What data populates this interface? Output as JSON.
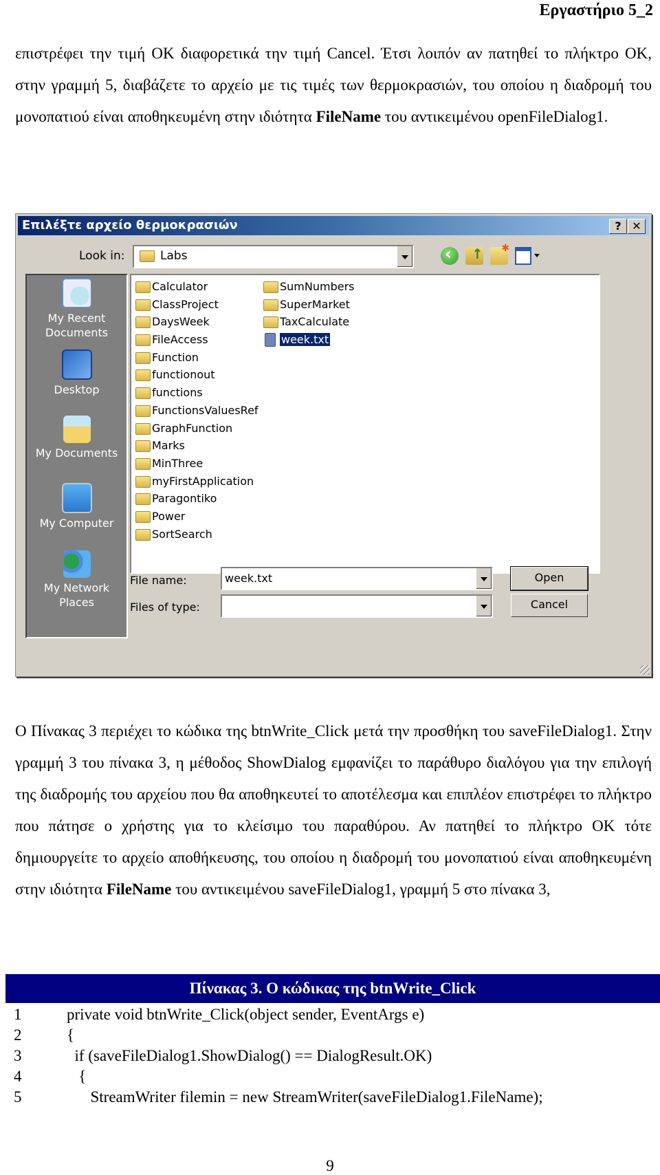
{
  "header": {
    "title": "Εργαστήριο 5_2"
  },
  "paragraph1": {
    "text_before_bold": "επιστρέφει την τιμή OK διαφορετικά την τιμή Cancel. Έτσι λοιπόν αν πατηθεί το πλήκτρο OK, στην γραμμή 5, διαβάζετε το αρχείο με τις τιμές των θερμοκρασιών, του οποίου η διαδρομή του μονοπατιού είναι αποθηκευμένη στην ιδιότητα ",
    "bold": "FileName",
    "text_after_bold": " του αντικειμένου openFileDialog1."
  },
  "dialog": {
    "title": "Επιλέξτε αρχείο θερμοκρασιών",
    "help_button": "?",
    "close_button": "✕",
    "look_in_label": "Look in:",
    "look_in_value": "Labs",
    "places": [
      {
        "label": "My Recent Documents",
        "icon": "recent-documents-icon"
      },
      {
        "label": "Desktop",
        "icon": "desktop-icon"
      },
      {
        "label": "My Documents",
        "icon": "my-documents-icon"
      },
      {
        "label": "My Computer",
        "icon": "my-computer-icon"
      },
      {
        "label": "My Network Places",
        "icon": "network-places-icon"
      }
    ],
    "files_col1": [
      "Calculator",
      "ClassProject",
      "DaysWeek",
      "FileAccess",
      "Function",
      "functionout",
      "functions",
      "FunctionsValuesRef",
      "GraphFunction",
      "Marks",
      "MinThree",
      "myFirstApplication",
      "Paragontiko",
      "Power",
      "SortSearch"
    ],
    "files_col2": [
      {
        "name": "SumNumbers",
        "type": "folder"
      },
      {
        "name": "SuperMarket",
        "type": "folder"
      },
      {
        "name": "TaxCalculate",
        "type": "folder"
      },
      {
        "name": "week.txt",
        "type": "text-file",
        "selected": true
      }
    ],
    "file_name_label": "File name:",
    "file_name_value": "week.txt",
    "files_of_type_label": "Files of type:",
    "files_of_type_value": "",
    "open_button": "Open",
    "cancel_button": "Cancel"
  },
  "paragraph2": {
    "text_before_bold": "Ο Πίνακας 3 περιέχει το κώδικα της btnWrite_Click μετά την προσθήκη του saveFileDialog1. Στην γραμμή 3 του πίνακα 3, η μέθοδος ShowDialog εμφανίζει το παράθυρο διαλόγου για την επιλογή της διαδρομής του αρχείου που θα αποθηκευτεί το αποτέλεσμα και επιπλέον επιστρέφει το πλήκτρο που πάτησε ο χρήστης για το κλείσιμο του παραθύρου. Αν πατηθεί το πλήκτρο OK τότε δημιουργείτε το αρχείο αποθήκευσης, του οποίου η διαδρομή του μονοπατιού είναι αποθηκευμένη στην ιδιότητα ",
    "bold": "FileName",
    "text_after_bold": " του αντικειμένου saveFileDialog1, γραμμή 5 στο πίνακα 3,"
  },
  "code_table": {
    "caption": "Πίνακας 3. Ο κώδικας της btnWrite_Click",
    "lines": [
      {
        "n": "1",
        "code": "private void btnWrite_Click(object sender, EventArgs e)"
      },
      {
        "n": "2",
        "code": "{"
      },
      {
        "n": "3",
        "code": "  if (saveFileDialog1.ShowDialog() == DialogResult.OK)"
      },
      {
        "n": "4",
        "code": "   {"
      },
      {
        "n": "5",
        "code": "      StreamWriter filemin = new StreamWriter(saveFileDialog1.FileName);"
      }
    ]
  },
  "footer": {
    "page_number": "9"
  }
}
